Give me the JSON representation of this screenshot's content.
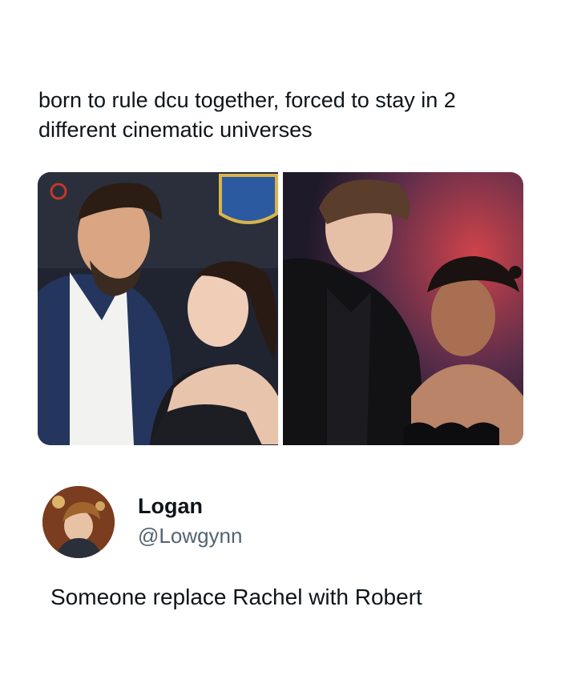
{
  "post": {
    "text": "born to rule dcu together, forced to stay in 2 different cinematic universes"
  },
  "photos": [
    {
      "icon": "red-carpet-couple-photo-left"
    },
    {
      "icon": "red-carpet-couple-photo-right"
    }
  ],
  "reply": {
    "name": "Logan",
    "handle": "@Lowgynn",
    "text": "Someone replace Rachel with Robert"
  },
  "colors": {
    "text": "#0f1419",
    "secondary_text": "#536471",
    "background": "#ffffff"
  }
}
